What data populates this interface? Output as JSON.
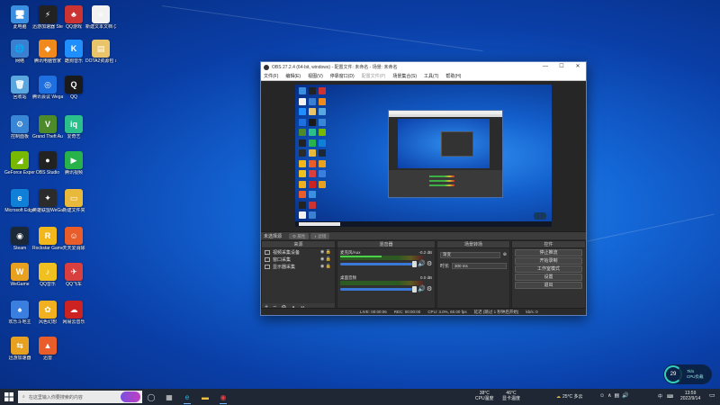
{
  "desktop": {
    "icons": [
      {
        "label": "此电脑",
        "glyph": "🖥",
        "color": "#3b8fe0"
      },
      {
        "label": "迅游加速器 SteamDeck",
        "glyph": "⚡",
        "color": "#222"
      },
      {
        "label": "QQ游戏",
        "glyph": "♣",
        "color": "#c33"
      },
      {
        "label": "新建文本文档 (3).txt",
        "glyph": "≡",
        "color": "#f2f2f2"
      },
      {
        "label": "网络",
        "glyph": "🌐",
        "color": "#3a7fd0"
      },
      {
        "label": "腾讯电脑管家",
        "glyph": "◆",
        "color": "#f08a1c"
      },
      {
        "label": "酷狗音乐",
        "glyph": "K",
        "color": "#1f8fff"
      },
      {
        "label": "DOTA2资源包 x86",
        "glyph": "▤",
        "color": "#e9c46a"
      },
      {
        "label": "回收站",
        "glyph": "🗑",
        "color": "#5aa7e0"
      },
      {
        "label": "腾讯会议 Wegame",
        "glyph": "◎",
        "color": "#1e6fe0"
      },
      {
        "label": "QQ",
        "glyph": "Q",
        "color": "#1a1a1a"
      },
      {
        "label": "控制面板",
        "glyph": "⚙",
        "color": "#3a86d6"
      },
      {
        "label": "Grand Theft Auto V",
        "glyph": "V",
        "color": "#4c8a2a"
      },
      {
        "label": "爱奇艺",
        "glyph": "iq",
        "color": "#2bbf8c"
      },
      {
        "label": "GeForce Experience",
        "glyph": "◢",
        "color": "#76b900"
      },
      {
        "label": "OBS Studio",
        "glyph": "●",
        "color": "#222"
      },
      {
        "label": "腾讯视频",
        "glyph": "▶",
        "color": "#27b24a"
      },
      {
        "label": "Microsoft Edge",
        "glyph": "e",
        "color": "#0f7fd8"
      },
      {
        "label": "英雄联盟WeGame版",
        "glyph": "✦",
        "color": "#2b2b2b"
      },
      {
        "label": "新建文件夹",
        "glyph": "▭",
        "color": "#e9b93b"
      },
      {
        "label": "Steam",
        "glyph": "◉",
        "color": "#1b2838"
      },
      {
        "label": "Rockstar Games Launcher",
        "glyph": "R",
        "color": "#f2b81b"
      },
      {
        "label": "天天爱消除",
        "glyph": "☺",
        "color": "#e85d2a"
      },
      {
        "label": "WeGame",
        "glyph": "W",
        "color": "#e8a020"
      },
      {
        "label": "QQ音乐",
        "glyph": "♪",
        "color": "#f0c020"
      },
      {
        "label": "QQ飞车",
        "glyph": "✈",
        "color": "#d84040"
      },
      {
        "label": "欢乐斗地主",
        "glyph": "♠",
        "color": "#3a7fe0"
      },
      {
        "label": "风色幻想",
        "glyph": "✿",
        "color": "#f0b020"
      },
      {
        "label": "网易云音乐",
        "glyph": "☁",
        "color": "#c22"
      },
      {
        "label": "迅游加速器",
        "glyph": "⇆",
        "color": "#e8a020"
      },
      {
        "label": "迅雷",
        "glyph": "▲",
        "color": "#e85d2a"
      }
    ]
  },
  "obs": {
    "title": "OBS 27.2.4 (64-bit, windows) - 配置文件: 未命名 - 场景: 未命名",
    "window_controls": [
      "—",
      "☐",
      "✕"
    ],
    "menu": [
      "文件(F)",
      "编辑(E)",
      "视图(V)",
      "停靠窗口(D)",
      "配置文件(P)",
      "场景集合(S)",
      "工具(T)",
      "帮助(H)"
    ],
    "scene_label": "未选择源",
    "panel_buttons": [
      "属性",
      "滤镜"
    ],
    "sources": {
      "title": "来源",
      "items": [
        "视频采集设备",
        "窗口采集",
        "显示器采集"
      ]
    },
    "mixer": {
      "title": "混音器",
      "channels": [
        {
          "name": "麦克风/Aux",
          "db": "-0.2 dB",
          "level": 0.5
        },
        {
          "name": "桌面音频",
          "db": "0.0 dB",
          "level": 0.0
        }
      ]
    },
    "transitions": {
      "title": "场景转场",
      "type": "渐变",
      "duration_label": "时长",
      "duration": "300 ms"
    },
    "controls": {
      "title": "控件",
      "buttons": [
        "停止推流",
        "开始录制",
        "工作室模式",
        "设置",
        "退出"
      ]
    },
    "status": {
      "live": "LIVE: 00:00:06",
      "rec": "REC: 00:00:00",
      "cpu": "CPU: 3.0%, 60.00 fps",
      "delay": "延迟 (跳过 1 秒钟后开始)",
      "kbps": "kb/s: 0"
    }
  },
  "taskbar": {
    "search_placeholder": "在这里输入你要搜索的内容",
    "gpu_temp": "38°C",
    "gpu_label": "CPU温度",
    "gpu2_temp": "46°C",
    "gpu2_label": "显卡温度",
    "weather": "25°C 多云",
    "ime": "中",
    "time": "13:59",
    "date": "2022/9/14"
  },
  "widget": {
    "percent": "29",
    "net": "7k/s",
    "label": "CPU负载"
  }
}
